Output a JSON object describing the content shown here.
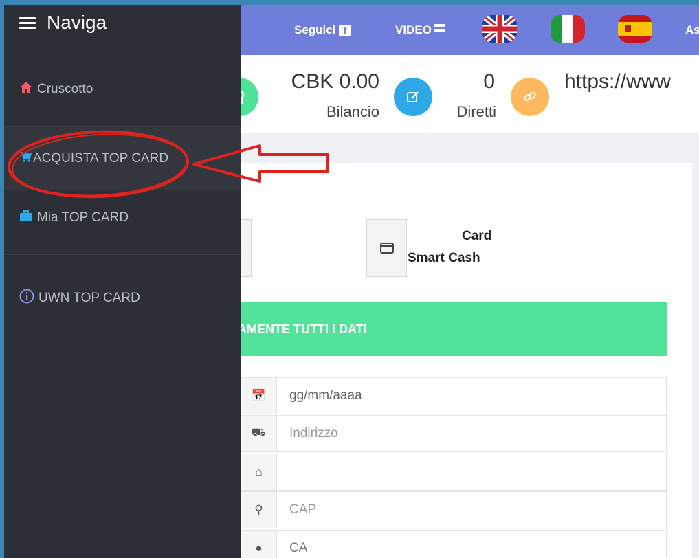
{
  "topbar": {
    "follow_label": "Seguici",
    "facebook_icon_glyph": "f",
    "video_label": "VIDEO",
    "cut_text": "As"
  },
  "stats": [
    {
      "value": "CBK 0.00",
      "label": "Bilancio",
      "color": "#4fe39a",
      "icon": "award-icon"
    },
    {
      "value": "0",
      "label": "Diretti",
      "color": "#2ea8e6",
      "icon": "edit-icon"
    },
    {
      "value": "https://www",
      "label": "",
      "color": "#ffb95e",
      "icon": "link-icon"
    }
  ],
  "payment": {
    "option_line1": "Card",
    "option_line2": "Smart Cash"
  },
  "alert_text": "AMENTE TUTTI I DATI",
  "form": {
    "date_placeholder": "gg/mm/aaaa",
    "address_placeholder": "Indirizzo",
    "home_value": "",
    "cap_placeholder": "CAP",
    "country_value": "CA"
  },
  "sidebar": {
    "title": "Naviga",
    "items": [
      {
        "label": "Cruscotto",
        "icon": "home-icon"
      },
      {
        "label": "ACQUISTA TOP CARD",
        "icon": "cart-icon"
      },
      {
        "label": "Mia TOP CARD",
        "icon": "briefcase-icon"
      },
      {
        "label": "UWN TOP CARD",
        "icon": "info-icon"
      }
    ]
  },
  "colors": {
    "topbar": "#6f7ddb",
    "sidebar": "#2c2f35",
    "alert": "#52e39b",
    "annotation": "#e0231f"
  }
}
